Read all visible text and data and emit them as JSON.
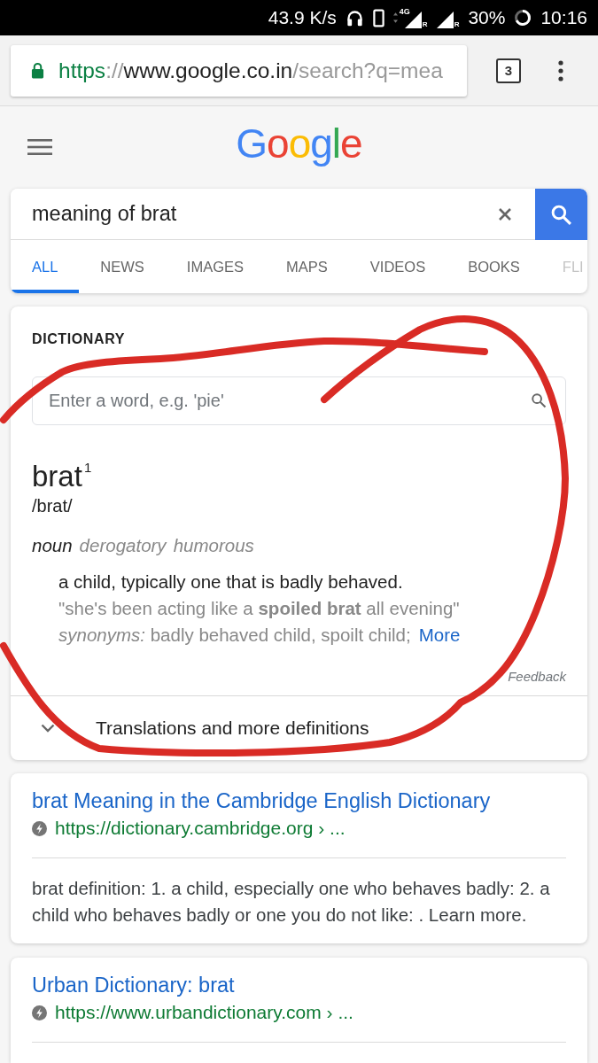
{
  "status_bar": {
    "speed": "43.9 K/s",
    "signals": [
      {
        "network": "4G",
        "badge": "R"
      },
      {
        "badge": "R"
      }
    ],
    "battery": "30%",
    "time": "10:16"
  },
  "browser": {
    "secure": true,
    "url": {
      "scheme": "https",
      "separator": "://",
      "host": "www.google.co.in",
      "path": "/search?q=mea"
    },
    "tab_count": "3"
  },
  "header": {
    "logo": "Google"
  },
  "search": {
    "query": "meaning of brat",
    "tabs": [
      {
        "label": "ALL",
        "selected": true
      },
      {
        "label": "NEWS",
        "selected": false
      },
      {
        "label": "IMAGES",
        "selected": false
      },
      {
        "label": "MAPS",
        "selected": false
      },
      {
        "label": "VIDEOS",
        "selected": false
      },
      {
        "label": "BOOKS",
        "selected": false
      },
      {
        "label": "FLI",
        "selected": false
      }
    ]
  },
  "dictionary": {
    "heading": "DICTIONARY",
    "placeholder": "Enter a word, e.g. 'pie'",
    "headword": "brat$^{1}$",
    "pronunciation": "/brat/",
    "part_of_speech": "noun",
    "labels": [
      "derogatory",
      "humorous"
    ],
    "definition": "a child, typically one that is badly behaved.",
    "example": "\"she's been acting like a **spoiled brat** all evening\"",
    "synonyms": "*synonyms:* badly behaved child, spoilt child;",
    "more": "More",
    "feedback": "Feedback",
    "expander": {
      "label": "Translations and more definitions",
      "expanded": false
    }
  },
  "results": [
    {
      "title": "brat Meaning in the Cambridge English Dictionary",
      "url": "https://dictionary.cambridge.org › ...",
      "snippet": "brat definition: 1. a child, especially one who behaves badly: 2. a child who behaves badly or one you do not like: . Learn more."
    },
    {
      "title": "Urban Dictionary: brat",
      "url": "https://www.urbandictionary.com › ..."
    }
  ]
}
